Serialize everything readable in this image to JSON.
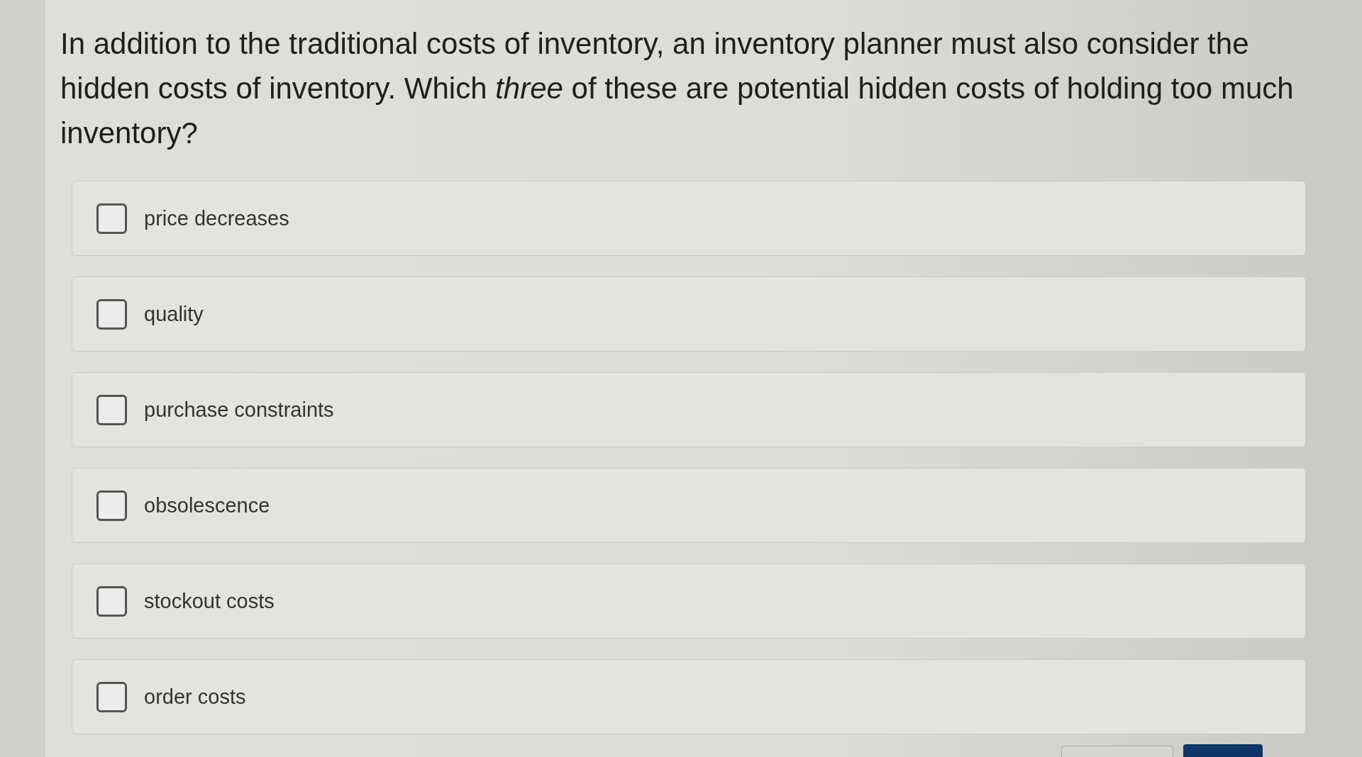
{
  "question": {
    "text": "In addition to the traditional costs of inventory, an inventory planner must also consider the hidden costs of inventory. Which *three* of these are potential hidden costs of holding too much inventory?"
  },
  "options": [
    {
      "label": "price decreases",
      "checked": false
    },
    {
      "label": "quality",
      "checked": false
    },
    {
      "label": "purchase constraints",
      "checked": false
    },
    {
      "label": "obsolescence",
      "checked": false
    },
    {
      "label": "stockout costs",
      "checked": false
    },
    {
      "label": "order costs",
      "checked": false
    }
  ]
}
